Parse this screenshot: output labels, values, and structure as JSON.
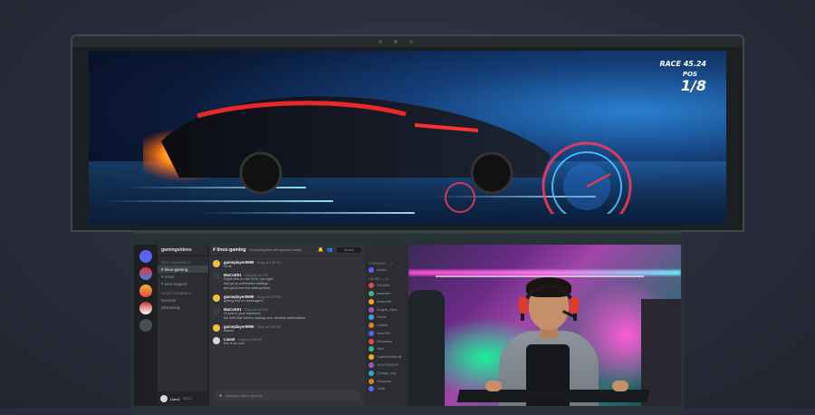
{
  "hud": {
    "race_time": "RACE 45.24",
    "pos_label": "POS",
    "pos_value": "1/8"
  },
  "discord": {
    "server_name": "gamingvideos",
    "categories": [
      "TEXT CHANNELS",
      "VOICE CHANNELS"
    ],
    "channels": [
      {
        "label": "# linux-gaming",
        "active": true
      },
      {
        "label": "# news",
        "active": false
      },
      {
        "label": "# tech-support",
        "active": false
      }
    ],
    "voice_channels": [
      "General",
      "Streaming"
    ],
    "user": {
      "name": "Liam1",
      "tag": "#3012"
    },
    "chat_header": {
      "channel": "# linux-gaming",
      "topic": "Everything linux and gaming related"
    },
    "search_placeholder": "Search",
    "messages": [
      {
        "user": "gameplayer9999",
        "time": "Today at 3:49 PM",
        "lines": [
          "Hi all"
        ]
      },
      {
        "user": "MaCoK91",
        "time": "Today at 3:51 PM",
        "lines": [
          "Right click on the GCK, top right",
          "and go to notification settings",
          "and you'll see the setting there"
        ]
      },
      {
        "user": "gameplayer9999",
        "time": "Today at 3:52 PM",
        "lines": [
          "getting this on messages?"
        ]
      },
      {
        "user": "MaCoK91",
        "time": "Today at 3:53 PM",
        "lines": [
          "Or just to your mentions",
          "but with that there's making sure desktop notifications"
        ]
      },
      {
        "user": "gameplayer9999",
        "time": "Today at 3:54 PM",
        "lines": [
          "thanks"
        ]
      },
      {
        "user": "Liam0",
        "time": "Today at 3:55 PM",
        "lines": [
          "this is so cool"
        ]
      }
    ],
    "composer_placeholder": "Message #linux-gaming",
    "members_groups": [
      {
        "title": "STREAMER — 1",
        "members": [
          "Liam0"
        ]
      },
      {
        "title": "ONLINE — 15",
        "members": [
          "NCubed",
          "ablorition",
          "Novem9k",
          "Angelic_Mew",
          "Richie",
          "Guldan",
          "neo1999",
          "Sebastian",
          "Ulric",
          "CaptainWellbuilt",
          "CoYITOCATS",
          "Cx4ngs_ong",
          "Shavenlo",
          "Cubb"
        ]
      }
    ]
  },
  "colors": {
    "discord_bg": "#313338",
    "sidebar_bg": "#2b2d31",
    "accent": "#5865f2"
  }
}
